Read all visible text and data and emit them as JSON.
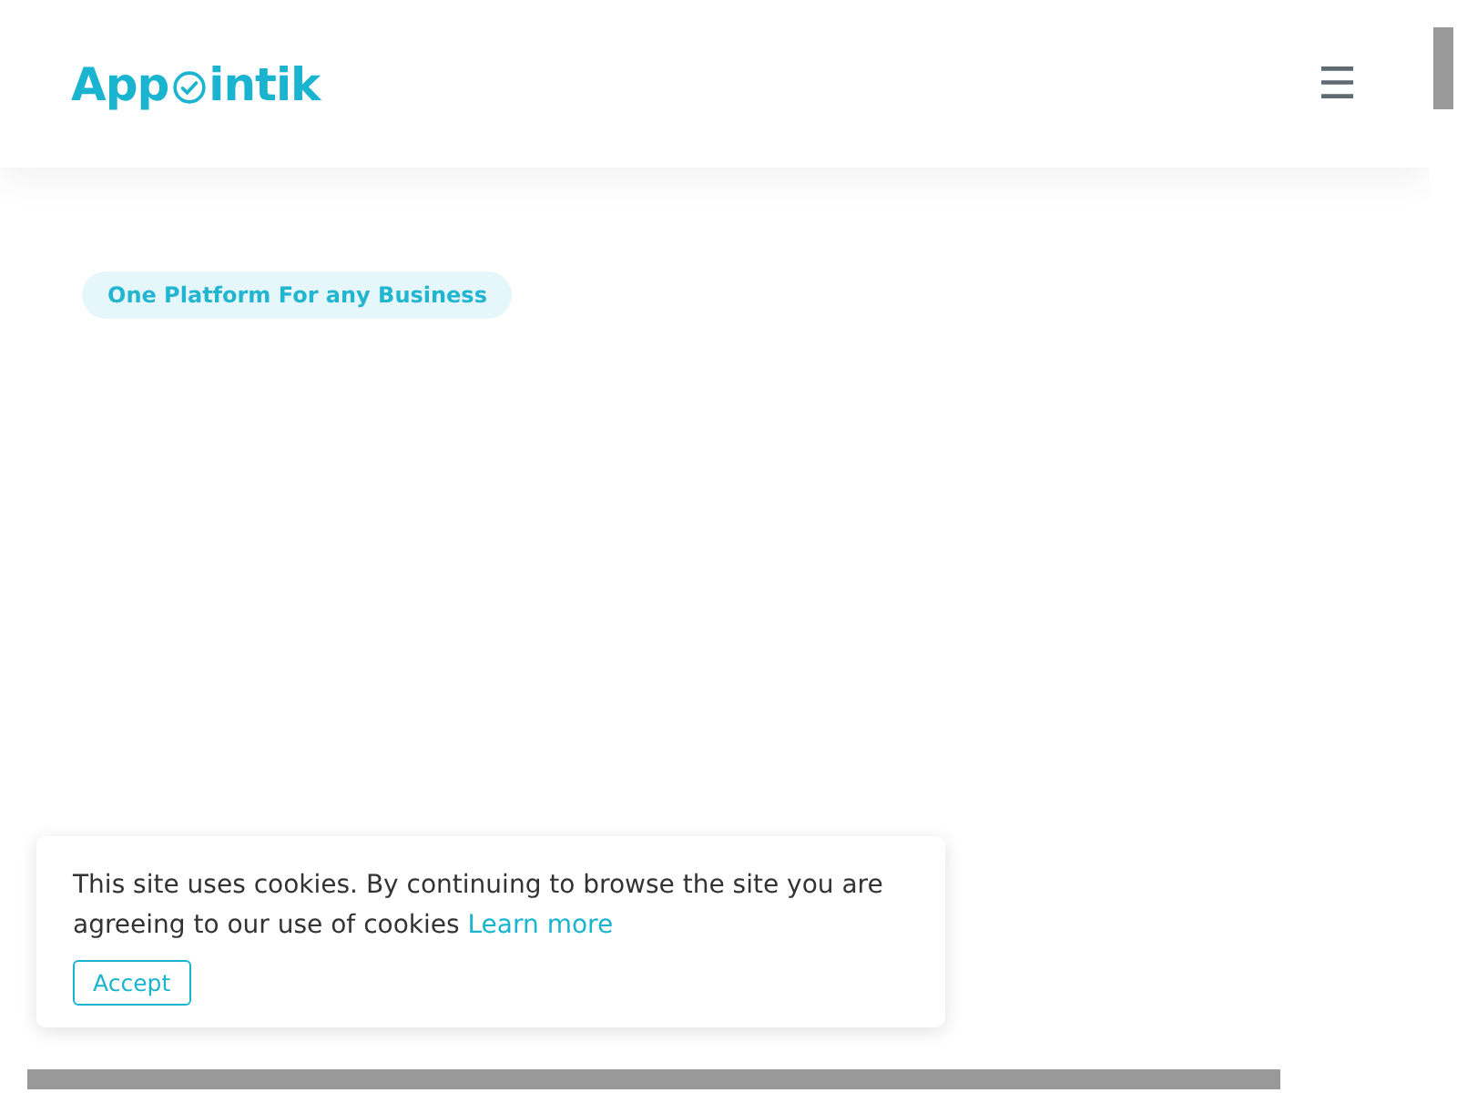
{
  "header": {
    "logo": {
      "before": "App",
      "after": "intik"
    },
    "menu_icon": "☰"
  },
  "hero": {
    "badge": "One Platform For any Business"
  },
  "cookie_banner": {
    "text": "This site uses cookies. By continuing to browse the site you are agreeing to our use of cookies",
    "link": "Learn more",
    "button": "Accept"
  }
}
